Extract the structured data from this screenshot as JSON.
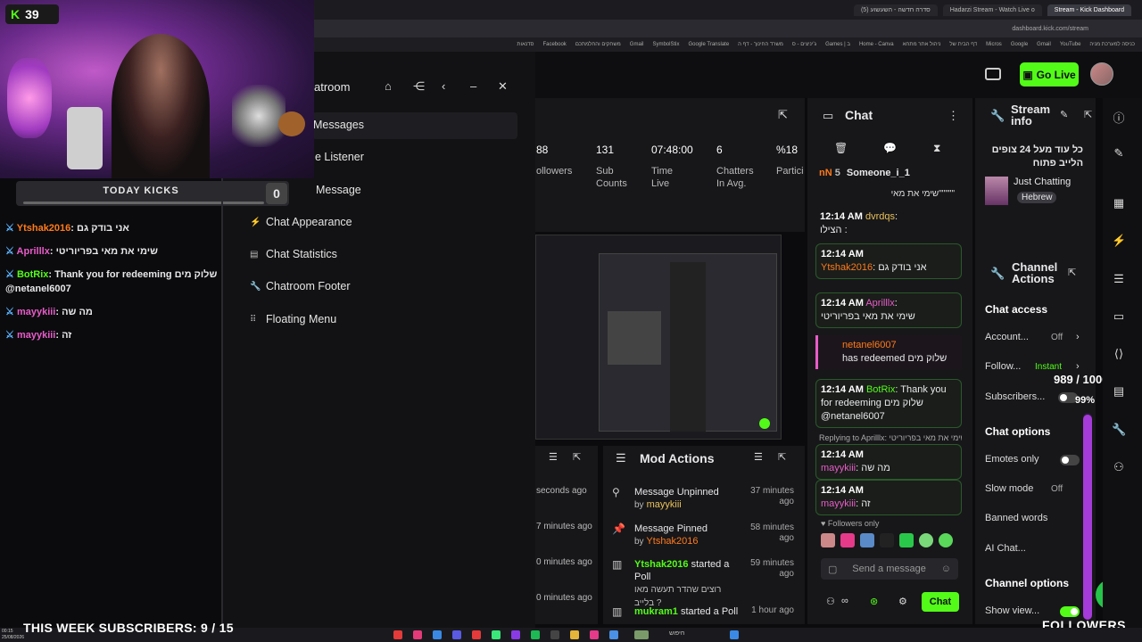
{
  "browser": {
    "tabs": [
      "Stream - Kick Dashboard",
      "Hadarzi Stream - Watch Live o",
      "(5) סדרה חדשה - השעשוע"
    ],
    "address": "dashboard.kick.com/stream",
    "bookmarks": [
      "סדנאות",
      "Facebook",
      "משחקים והחלמתכם",
      "Gmail",
      "SymbolStix",
      "Google Translate",
      "משרד החינוך - דף ה",
      "ג'יניצים - ס",
      "Games | ב",
      "Home - Canva",
      "ניהול אתר מתחא",
      "דף הבית של",
      "Micros",
      "Google",
      "Gmail",
      "YouTube",
      "כניסה למערכת מניה"
    ]
  },
  "overlay": {
    "kick_count": "39",
    "today_kicks_label": "TODAY KICKS",
    "today_kicks_value": "0",
    "chat": [
      {
        "name": "Ytshak2016",
        "text": "אני בודק גם",
        "color": "#ff7a1a"
      },
      {
        "name": "Aprilllx",
        "text": "שימי את מאי בפריוריטי",
        "color": "#e85cc9"
      },
      {
        "name": "BotRix",
        "text": "Thank you for redeeming שלוק מים @netanel6007",
        "color": "#53fc18"
      },
      {
        "name": "mayykiii",
        "text": "מה שה",
        "color": "#e85cc9"
      },
      {
        "name": "mayykiii",
        "text": "זה",
        "color": "#e85cc9"
      }
    ],
    "week_subscribers": "THIS WEEK SUBSCRIBERS: 9 / 15",
    "taskbar_time": "00:15",
    "taskbar_date": "25/08/2026",
    "search": "חיפוש"
  },
  "menu": {
    "title": "atroom",
    "items": [
      {
        "label": "Messages",
        "icon": ""
      },
      {
        "label": "e Listener",
        "icon": ""
      },
      {
        "label": "Message",
        "icon": ""
      },
      {
        "label": "Chat Appearance",
        "icon": "bolt-icon"
      },
      {
        "label": "Chat Statistics",
        "icon": "chart-icon"
      },
      {
        "label": "Chatroom Footer",
        "icon": "wrench-icon"
      },
      {
        "label": "Floating Menu",
        "icon": "grid-icon"
      }
    ]
  },
  "stats": [
    {
      "value": "88",
      "label": "ollowers"
    },
    {
      "value": "131",
      "label": "Sub Counts"
    },
    {
      "value": "07:48:00",
      "label": "Time Live"
    },
    {
      "value": "6",
      "label": "Chatters In Avg."
    },
    {
      "value": "%18",
      "label": "Partici"
    }
  ],
  "lower_left_times": [
    "seconds ago",
    "7 minutes ago",
    "0 minutes ago",
    "0 minutes ago"
  ],
  "mod_actions": {
    "title": "Mod Actions",
    "entries": [
      {
        "action": "Message Unpinned",
        "by_prefix": "by",
        "by": "mayykiii",
        "time": "37 minutes ago"
      },
      {
        "action": "Message Pinned",
        "by_prefix": "by",
        "by": "Ytshak2016",
        "time": "58 minutes ago"
      },
      {
        "user": "Ytshak2016",
        "action": "started a Poll",
        "detail": "רוצים שהדר תעשה מאו בלייב ?",
        "time": "59 minutes ago"
      },
      {
        "user": "mukram1",
        "action": "started a Poll",
        "time": "1 hour ago"
      }
    ]
  },
  "chat": {
    "title": "Chat",
    "pinned_prefix": "nN",
    "pinned_count": "5",
    "pinned_user": "Someone_i_1",
    "pinned_text": "שימי את מאי\"\"\"\"\"",
    "messages": [
      {
        "time": "12:14 AM",
        "user": "dvrdqs",
        "text": "הצילו :",
        "color": "#e8c15a"
      },
      {
        "time": "12:14 AM",
        "user": "Ytshak2016",
        "text": "אני בודק גם",
        "color": "#ff7a1a"
      },
      {
        "time": "12:14 AM",
        "user": "Aprilllx",
        "text": "שימי את מאי בפריוריטי",
        "color": "#e85cc9"
      },
      {
        "time": "",
        "user": "netanel6007",
        "text": "has redeemed שלוק מים",
        "color": "#ff7a1a"
      },
      {
        "time": "12:14 AM",
        "user": "BotRix",
        "text": "Thank you for redeeming שלוק מים @netanel6007",
        "color": "#53fc18"
      },
      {
        "time": "12:14 AM",
        "user": "mayykiii",
        "text": "מה שה",
        "color": "#e85cc9",
        "reply": "Replying to Aprilllx: שימי את מאי בפריוריטי"
      },
      {
        "time": "12:14 AM",
        "user": "mayykiii",
        "text": "זה",
        "color": "#e85cc9"
      }
    ],
    "followers_only": "Followers only",
    "input_placeholder": "Send a message",
    "send_label": "Chat"
  },
  "stream_info": {
    "title": "Stream info",
    "stream_title": "כל עוד מעל 24 צופים הלייב פתוח",
    "category": "Just Chatting",
    "tag": "Hebrew"
  },
  "channel_actions": {
    "title": "Channel Actions",
    "chat_access": "Chat access",
    "account_label": "Account...",
    "account_val": "Off",
    "follow_label": "Follow...",
    "follow_val": "Instant",
    "subs_label": "Subscribers...",
    "chat_options": "Chat options",
    "emotes_only": "Emotes only",
    "slow_mode": "Slow mode",
    "slow_val": "Off",
    "banned_words": "Banned words",
    "ai_chat": "AI Chat...",
    "channel_options": "Channel options",
    "show_view": "Show view..."
  },
  "goal": {
    "count": "989 / 1000",
    "percent": "99%",
    "progress_fraction": 0.99,
    "label": "FOLLOWERS"
  },
  "header": {
    "go_live": "Go Live"
  },
  "colors": {
    "kick_green": "#53fc18",
    "accent_purple": "#a53bd8"
  }
}
